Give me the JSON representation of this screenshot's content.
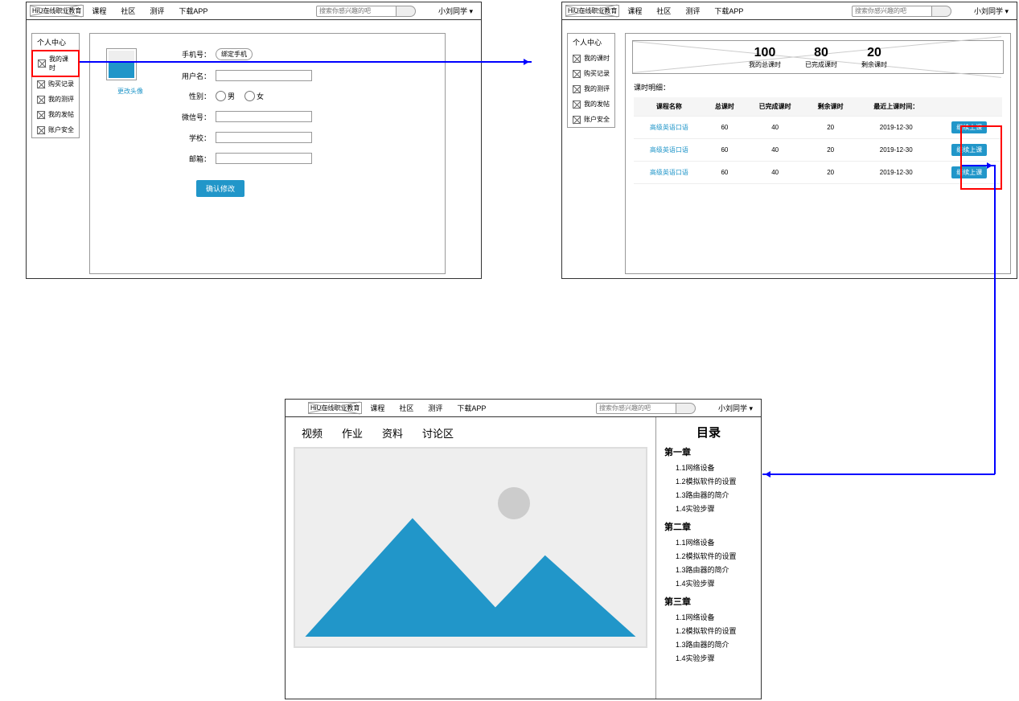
{
  "header": {
    "logo": "HiU在线职业教育",
    "nav": [
      "课程",
      "社区",
      "测评",
      "下载APP"
    ],
    "search_placeholder": "搜索你感兴趣的吧",
    "user": "小刘同学 ▾"
  },
  "sidebar": {
    "title": "个人中心",
    "items": [
      "我的课时",
      "购买记录",
      "我的测评",
      "我的发帖",
      "账户安全"
    ]
  },
  "profile_form": {
    "avatar_label": "更改头像",
    "phone_label": "手机号：",
    "bind_phone": "绑定手机",
    "username_label": "用户名：",
    "gender_label": "性别：",
    "gender_male": "男",
    "gender_female": "女",
    "wechat_label": "微信号：",
    "school_label": "学校：",
    "email_label": "邮箱：",
    "submit": "确认修改"
  },
  "stats": [
    {
      "num": "100",
      "label": "我的总课时"
    },
    {
      "num": "80",
      "label": "已完成课时"
    },
    {
      "num": "20",
      "label": "剩余课时"
    }
  ],
  "detail_title": "课时明细：",
  "table": {
    "headers": [
      "课程名称",
      "总课时",
      "已完成课时",
      "剩余课时",
      "最近上课时间：",
      ""
    ],
    "rows": [
      {
        "name": "高级英语口语",
        "total": "60",
        "done": "40",
        "left": "20",
        "date": "2019-12-30",
        "action": "继续上课"
      },
      {
        "name": "高级英语口语",
        "total": "60",
        "done": "40",
        "left": "20",
        "date": "2019-12-30",
        "action": "继续上课"
      },
      {
        "name": "高级英语口语",
        "total": "60",
        "done": "40",
        "left": "20",
        "date": "2019-12-30",
        "action": "继续上课"
      }
    ]
  },
  "course_tabs": [
    "视频",
    "作业",
    "资料",
    "讨论区"
  ],
  "toc": {
    "title": "目录",
    "chapters": [
      {
        "title": "第一章",
        "items": [
          "1.1网络设备",
          "1.2模拟软件的设置",
          "1.3路由器的简介",
          "1.4实验步骤"
        ]
      },
      {
        "title": "第二章",
        "items": [
          "1.1网络设备",
          "1.2模拟软件的设置",
          "1.3路由器的简介",
          "1.4实验步骤"
        ]
      },
      {
        "title": "第三章",
        "items": [
          "1.1网络设备",
          "1.2模拟软件的设置",
          "1.3路由器的简介",
          "1.4实验步骤"
        ]
      }
    ]
  }
}
